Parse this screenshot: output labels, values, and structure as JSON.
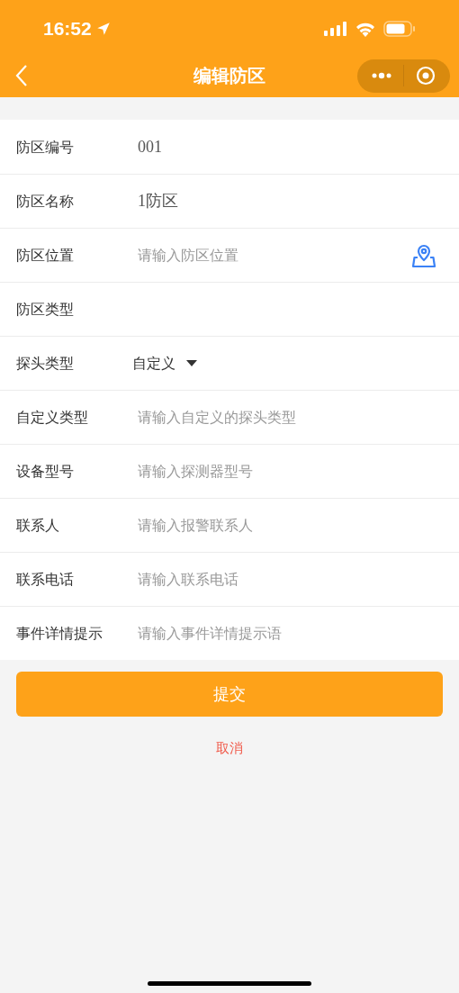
{
  "status_bar": {
    "time": "16:52"
  },
  "nav_bar": {
    "title": "编辑防区"
  },
  "rows": [
    {
      "kind": "text",
      "label": "防区编号",
      "value": "001"
    },
    {
      "kind": "text",
      "label": "防区名称",
      "value": "1防区"
    },
    {
      "kind": "location",
      "label": "防区位置",
      "placeholder": "请输入防区位置"
    },
    {
      "kind": "blank",
      "label": "防区类型"
    },
    {
      "kind": "select",
      "label": "探头类型",
      "value": "自定义"
    },
    {
      "kind": "text",
      "label": "自定义类型",
      "placeholder": "请输入自定义的探头类型"
    },
    {
      "kind": "text",
      "label": "设备型号",
      "placeholder": "请输入探测器型号"
    },
    {
      "kind": "text",
      "label": "联系人",
      "placeholder": "请输入报警联系人"
    },
    {
      "kind": "text",
      "label": "联系电话",
      "placeholder": "请输入联系电话"
    },
    {
      "kind": "text",
      "label": "事件详情提示",
      "placeholder": "请输入事件详情提示语"
    }
  ],
  "submit_button": "提交",
  "cancel_link": "取消"
}
